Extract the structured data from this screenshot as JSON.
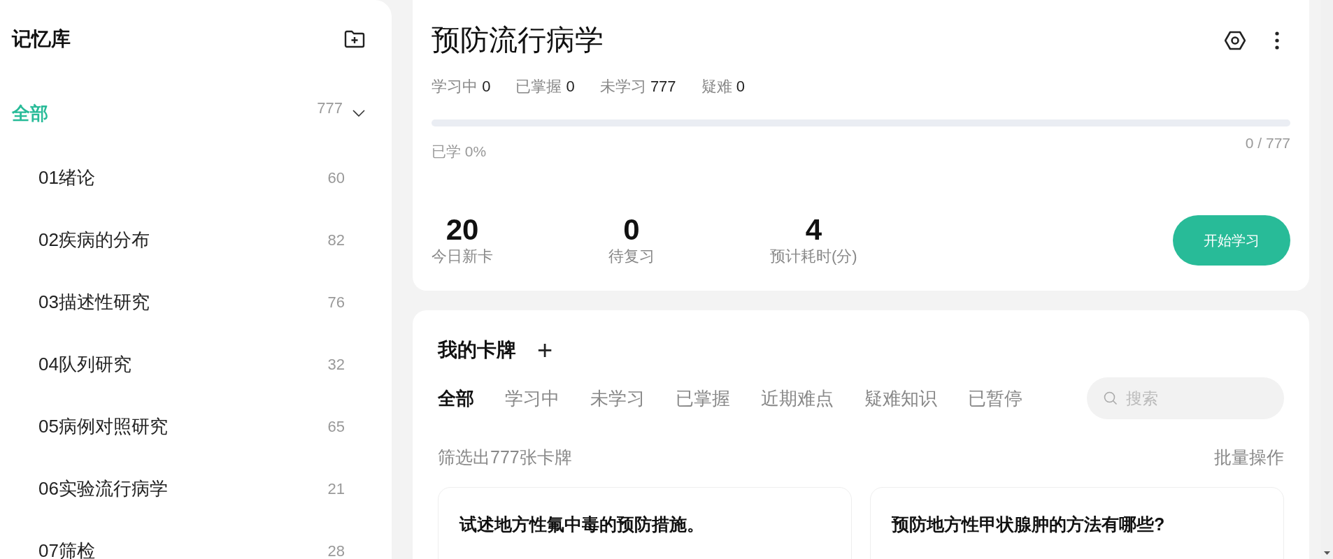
{
  "sidebar": {
    "title": "记忆库",
    "root": {
      "label": "全部",
      "count": "777",
      "selected": true,
      "expanded": true,
      "children": [
        {
          "label": "01绪论",
          "count": "60",
          "selected": false
        },
        {
          "label": "02疾病的分布",
          "count": "82",
          "selected": false
        },
        {
          "label": "03描述性研究",
          "count": "76",
          "selected": false
        },
        {
          "label": "04队列研究",
          "count": "32",
          "selected": false
        },
        {
          "label": "05病例对照研究",
          "count": "65",
          "selected": false
        },
        {
          "label": "06实验流行病学",
          "count": "21",
          "selected": false
        },
        {
          "label": "07筛检",
          "count": "28",
          "selected": false
        }
      ]
    }
  },
  "deck": {
    "title": "预防流行病学",
    "counts": [
      {
        "label": "学习中",
        "value": "0"
      },
      {
        "label": "已掌握",
        "value": "0"
      },
      {
        "label": "未学习",
        "value": "777"
      },
      {
        "label": "疑难",
        "value": "0"
      }
    ],
    "progress": {
      "level": 0,
      "label": "已学 0%",
      "reading": "0 / 777"
    },
    "stats": [
      {
        "value": "20",
        "label": "今日新卡"
      },
      {
        "value": "0",
        "label": "待复习"
      },
      {
        "value": "4",
        "label": "预计耗时(分)"
      }
    ],
    "start_button": "开始学习"
  },
  "cards": {
    "title": "我的卡牌",
    "add": "+",
    "tabs": [
      {
        "label": "全部",
        "selected": true
      },
      {
        "label": "学习中",
        "selected": false
      },
      {
        "label": "未学习",
        "selected": false
      },
      {
        "label": "已掌握",
        "selected": false
      },
      {
        "label": "近期难点",
        "selected": false
      },
      {
        "label": "疑难知识",
        "selected": false
      },
      {
        "label": "已暂停",
        "selected": false
      }
    ],
    "search": {
      "placeholder": "搜索"
    },
    "filter_text": "筛选出777张卡牌",
    "batch": "批量操作",
    "items": [
      {
        "question": "试述地方性氟中毒的预防措施。"
      },
      {
        "question": "预防地方性甲状腺肿的方法有哪些?"
      }
    ]
  }
}
